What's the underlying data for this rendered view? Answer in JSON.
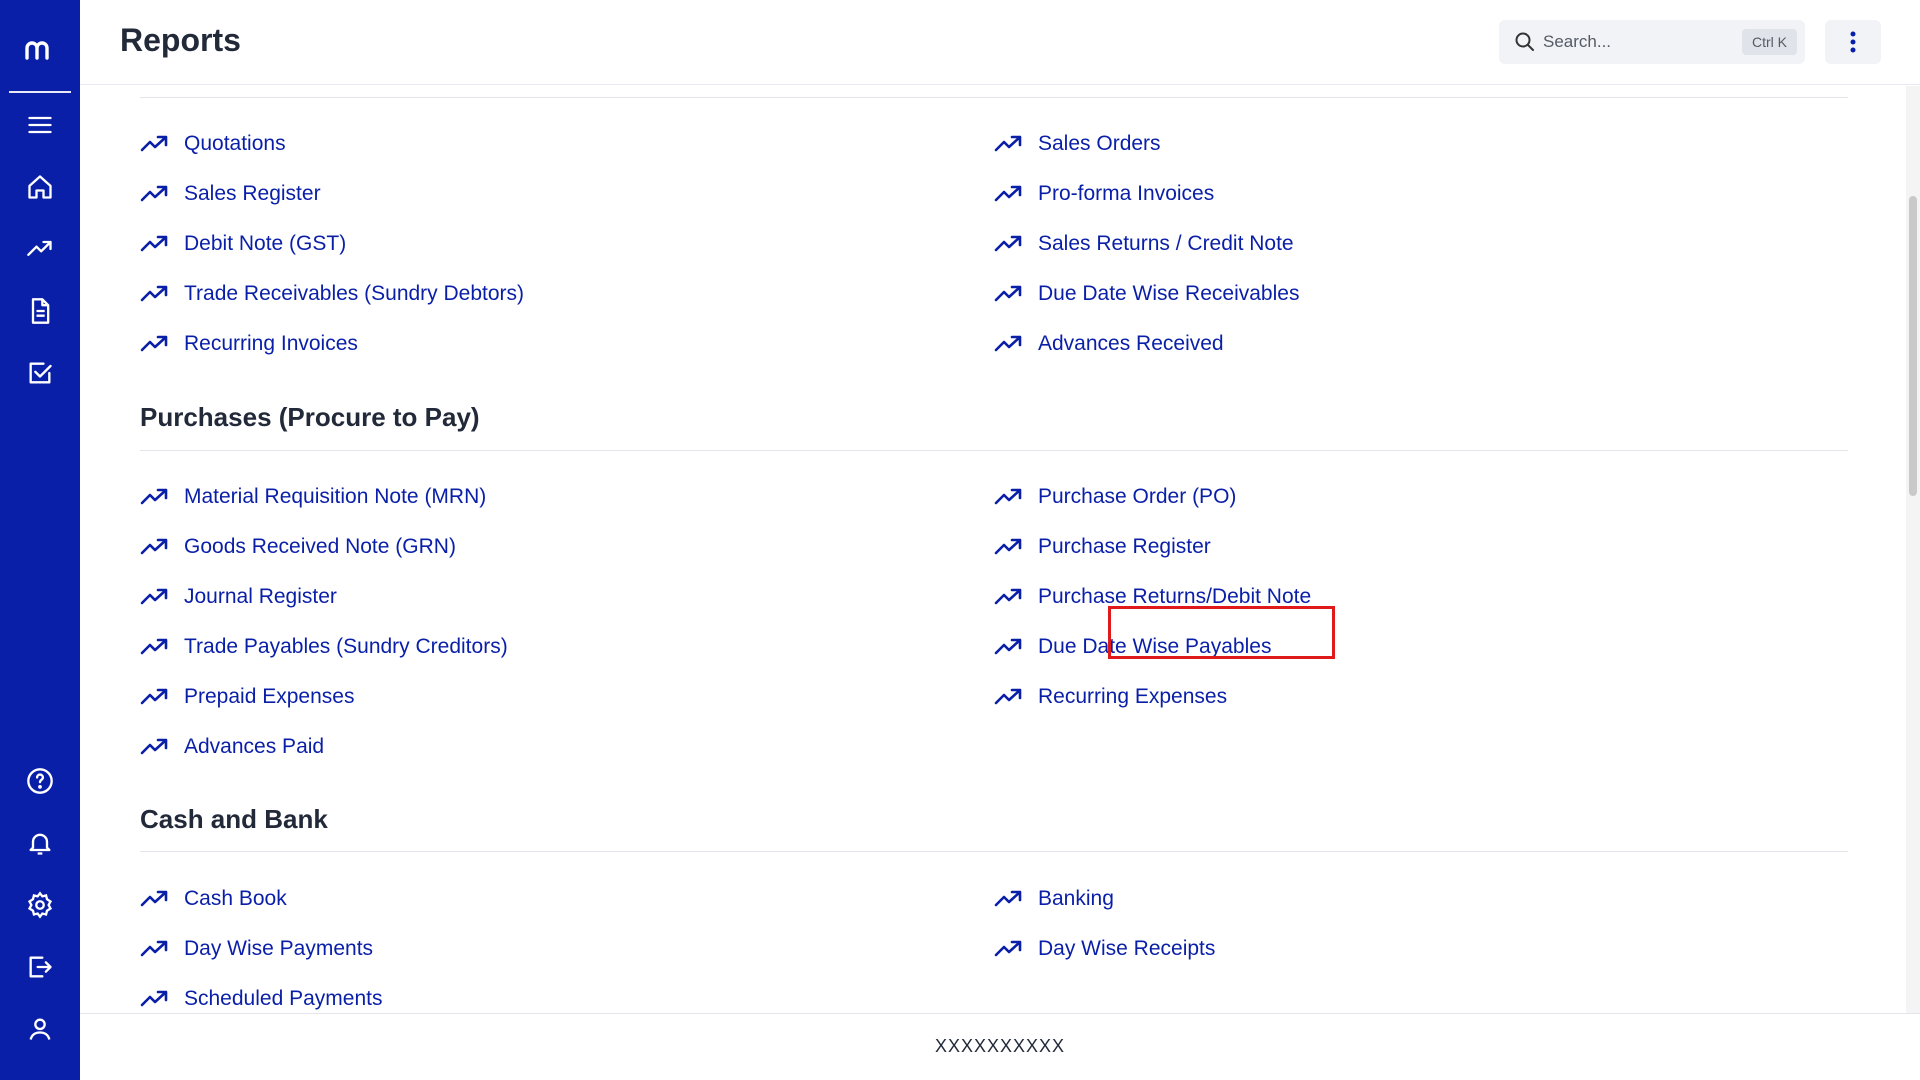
{
  "app": {
    "logo_icon": "m-logo-icon"
  },
  "sidebar": {
    "top_items": [
      {
        "icon": "menu-icon",
        "label": "Menu"
      },
      {
        "icon": "home-icon",
        "label": "Home"
      },
      {
        "icon": "trending-up-icon",
        "label": "Reports"
      },
      {
        "icon": "document-icon",
        "label": "Documents"
      },
      {
        "icon": "checkbox-icon",
        "label": "Tasks"
      }
    ],
    "bottom_items": [
      {
        "icon": "help-icon",
        "label": "Help"
      },
      {
        "icon": "bell-icon",
        "label": "Notifications"
      },
      {
        "icon": "gear-icon",
        "label": "Settings"
      },
      {
        "icon": "logout-icon",
        "label": "Logout"
      },
      {
        "icon": "user-icon",
        "label": "Profile"
      }
    ]
  },
  "header": {
    "title": "Reports",
    "search": {
      "placeholder": "Search...",
      "shortcut": "Ctrl K"
    },
    "more_icon": "kebab-menu-icon"
  },
  "sales_links": {
    "left": [
      "Quotations",
      "Sales Register",
      "Debit Note (GST)",
      "Trade Receivables (Sundry Debtors)",
      "Recurring Invoices"
    ],
    "right": [
      "Sales Orders",
      "Pro-forma Invoices",
      "Sales Returns / Credit Note",
      "Due Date Wise Receivables",
      "Advances Received"
    ]
  },
  "purchases": {
    "title": "Purchases (Procure to Pay)",
    "left": [
      "Material Requisition Note (MRN)",
      "Goods Received Note (GRN)",
      "Journal Register",
      "Trade Payables (Sundry Creditors)",
      "Prepaid Expenses",
      "Advances Paid"
    ],
    "right": [
      "Purchase Order (PO)",
      "Purchase Register",
      "Purchase Returns/Debit Note",
      "Due Date Wise Payables",
      "Recurring Expenses"
    ]
  },
  "cash_bank": {
    "title": "Cash and Bank",
    "left": [
      "Cash Book",
      "Day Wise Payments",
      "Scheduled Payments"
    ],
    "right": [
      "Banking",
      "Day Wise Receipts"
    ]
  },
  "footer": {
    "text": "XXXXXXXXXX"
  },
  "colors": {
    "sidebar": "#0a1fa8",
    "link": "#0a1fa8",
    "highlight": "#e01a1a",
    "heading": "#222a3a"
  }
}
